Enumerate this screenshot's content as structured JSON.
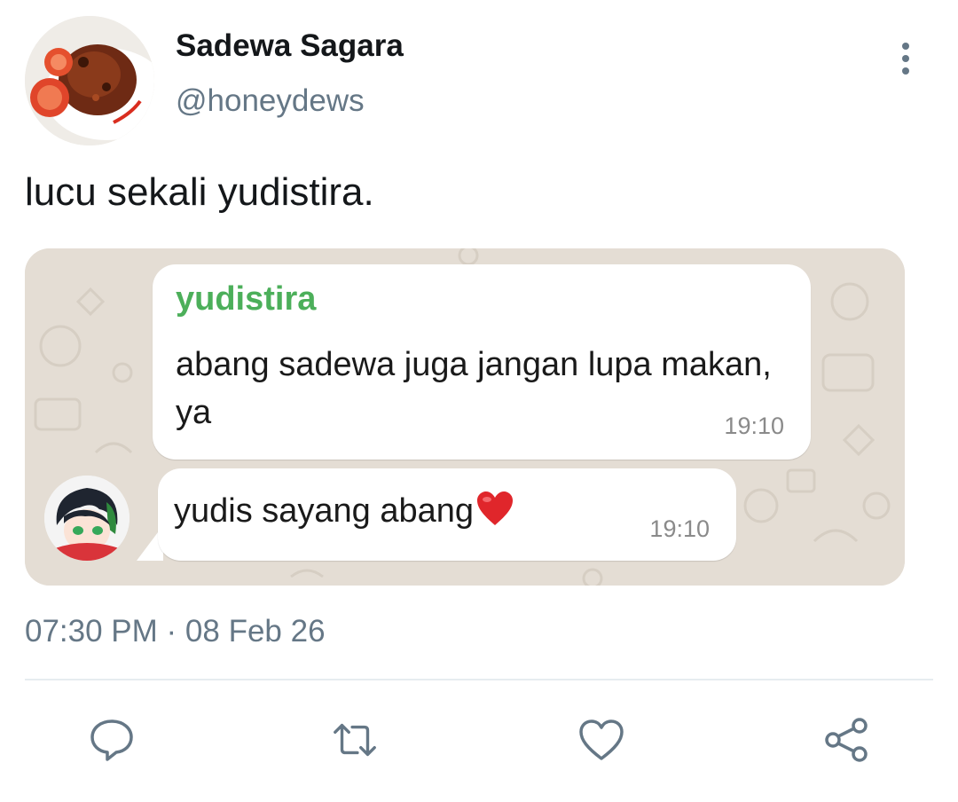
{
  "author": {
    "display_name": "Sadewa Sagara",
    "handle": "@honeydews"
  },
  "tweet": {
    "text": "lucu sekali yudistira.",
    "timestamp": "07:30 PM · 08 Feb 26"
  },
  "chat": {
    "messages": [
      {
        "sender": "yudistira",
        "text": "abang sadewa juga jangan lupa makan, ya",
        "time": "19:10"
      },
      {
        "text": "yudis sayang abang",
        "time": "19:10"
      }
    ]
  },
  "icons": {
    "more": "more-vertical-icon",
    "reply": "reply-icon",
    "retweet": "retweet-icon",
    "like": "heart-icon",
    "share": "share-icon"
  },
  "colors": {
    "sender_green": "#4caf5a",
    "secondary_text": "#657786",
    "chat_background": "#e4ddd4",
    "heart_red": "#e0262b"
  }
}
